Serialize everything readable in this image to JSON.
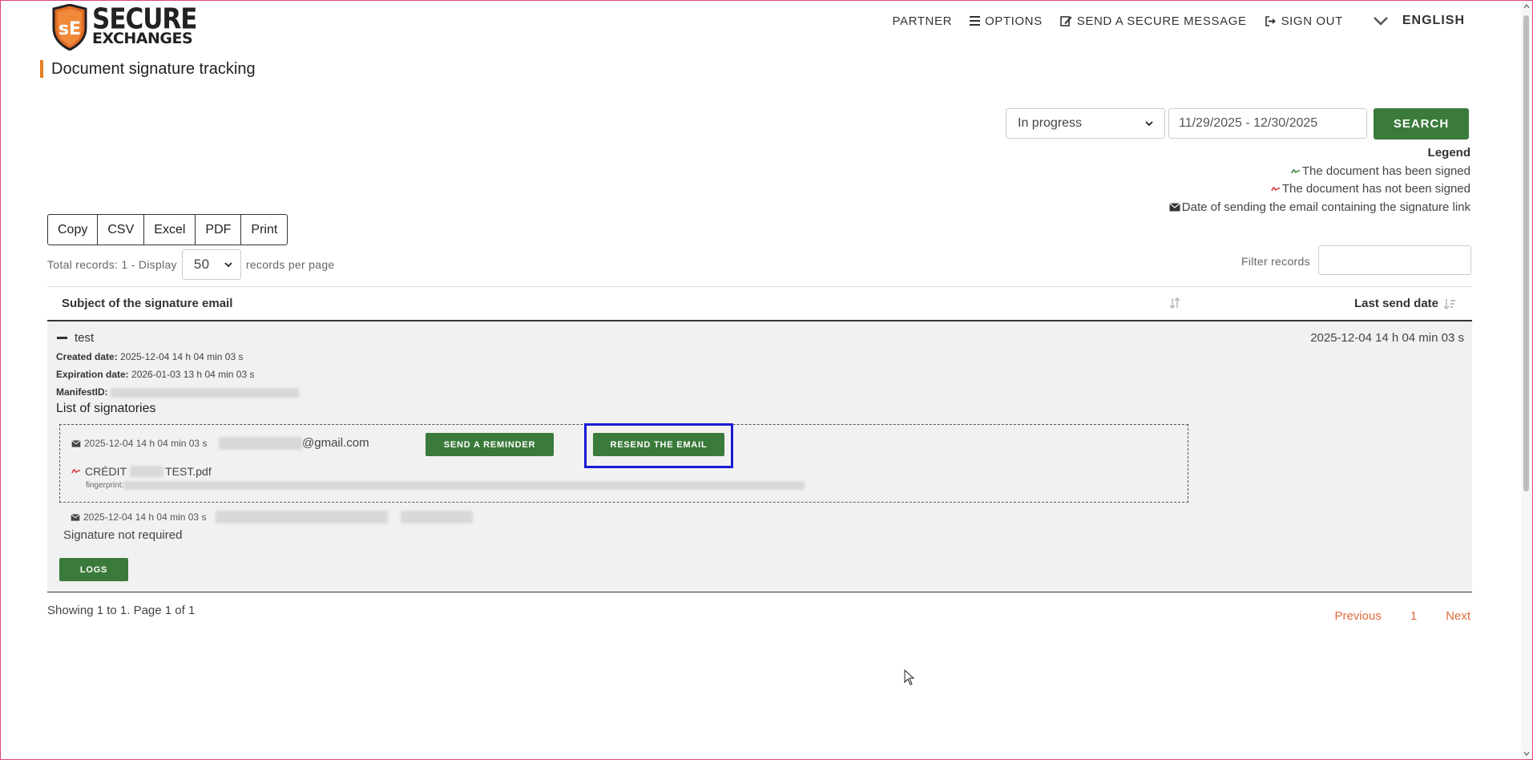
{
  "brand": {
    "line1": "SECURE",
    "line2": "EXCHANGES",
    "colors": {
      "shield": "#e06b25",
      "text": "#222222"
    }
  },
  "nav": {
    "partner": "PARTNER",
    "options": "OPTIONS",
    "send_secure": "SEND A SECURE MESSAGE",
    "sign_out": "SIGN OUT",
    "language": "ENGLISH"
  },
  "page": {
    "title": "Document signature tracking"
  },
  "search": {
    "status_value": "In progress",
    "date_range": "11/29/2025 - 12/30/2025",
    "button": "SEARCH"
  },
  "legend": {
    "title": "Legend",
    "signed": "The document has been signed",
    "not_signed": "The document has not been signed",
    "email_date": "Date of sending the email containing the signature link"
  },
  "export": {
    "copy": "Copy",
    "csv": "CSV",
    "excel": "Excel",
    "pdf": "PDF",
    "print": "Print"
  },
  "records": {
    "prefix": "Total records: 1 - Display",
    "per_page": "50",
    "suffix": "records per page",
    "filter_label": "Filter records"
  },
  "table": {
    "col_subject": "Subject of the signature email",
    "col_last_send": "Last send date",
    "row": {
      "subject": "test",
      "last_send": "2025-12-04 14 h 04 min 03 s",
      "created_label": "Created date:",
      "created_value": "2025-12-04 14 h 04 min 03 s",
      "expiration_label": "Expiration date:",
      "expiration_value": "2026-01-03 13 h 04 min 03 s",
      "manifest_label": "ManifestID:",
      "signatories_title": "List of signatories",
      "signatory1": {
        "sent_date": "2025-12-04 14 h 04 min 03 s",
        "email_suffix": "@gmail.com",
        "reminder_button": "SEND A REMINDER",
        "resend_button": "RESEND THE EMAIL",
        "file_prefix": "CRÉDIT",
        "file_suffix": "TEST.pdf",
        "fingerprint_label": "fingerprint:"
      },
      "signatory2": {
        "sent_date": "2025-12-04 14 h 04 min 03 s",
        "status": "Signature not required"
      },
      "logs_button": "LOGS"
    }
  },
  "footer": {
    "showing": "Showing 1 to 1. Page 1 of 1",
    "previous": "Previous",
    "page": "1",
    "next": "Next"
  }
}
